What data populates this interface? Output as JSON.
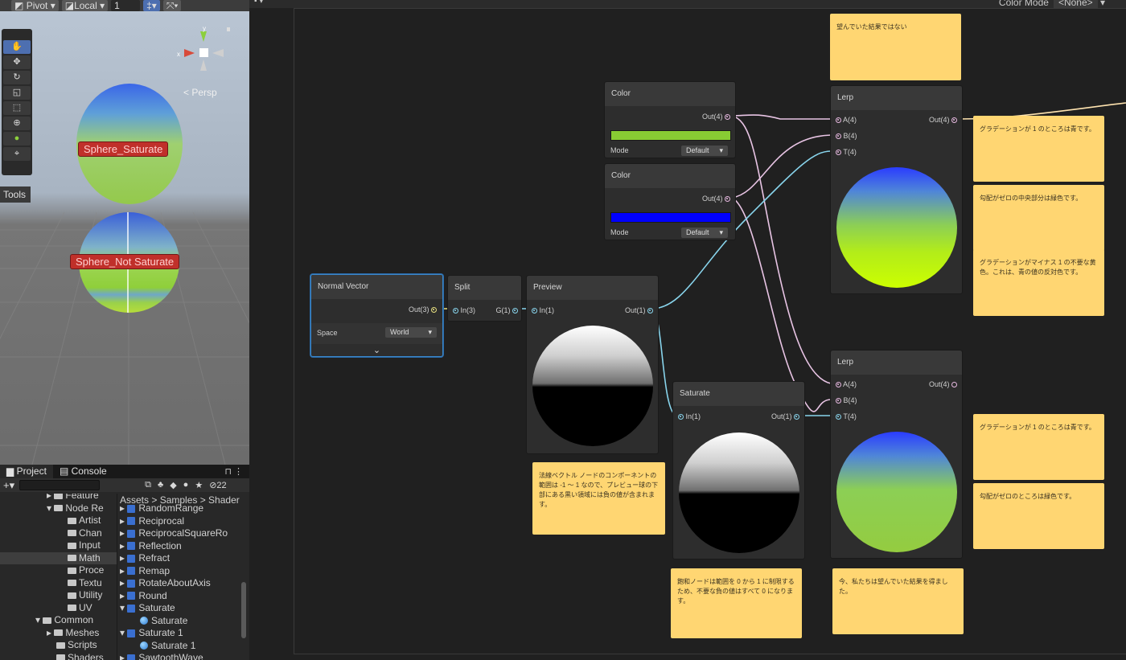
{
  "scene": {
    "toolbar": {
      "pivot": "Pivot",
      "local": "Local",
      "snap": "1"
    },
    "persp": "< Persp",
    "gizmo_x": "x",
    "gizmo_y": "y",
    "objects": {
      "top": "Sphere_Saturate",
      "bottom": "Sphere_Not Saturate"
    },
    "tools_label": "Tools"
  },
  "project": {
    "tabs": [
      "Project",
      "Console"
    ],
    "hidden_count": "22",
    "breadcrumb": "Assets > Samples > Shader",
    "tree": [
      "Feature",
      "Node Re",
      "Artist",
      "Chan",
      "Input",
      "Math",
      "Proce",
      "Textu",
      "Utility",
      "UV",
      "Common",
      "Meshes",
      "Scripts",
      "Shaders"
    ],
    "files": [
      "RandomRange",
      "Reciprocal",
      "ReciprocalSquareRo",
      "Reflection",
      "Refract",
      "Remap",
      "RotateAboutAxis",
      "Round",
      "Saturate",
      "Saturate",
      "Saturate 1",
      "Saturate 1",
      "SawtoothWave"
    ]
  },
  "graph": {
    "color_mode_label": "Color Mode",
    "color_mode_value": "<None>",
    "nodes": {
      "normal_vector": {
        "title": "Normal Vector",
        "out": "Out(3)",
        "space_label": "Space",
        "space_value": "World"
      },
      "split": {
        "title": "Split",
        "in": "In(3)",
        "out": "G(1)"
      },
      "preview": {
        "title": "Preview",
        "in": "In(1)",
        "out": "Out(1)"
      },
      "color1": {
        "title": "Color",
        "out": "Out(4)",
        "mode_label": "Mode",
        "mode_value": "Default"
      },
      "color2": {
        "title": "Color",
        "out": "Out(4)",
        "mode_label": "Mode",
        "mode_value": "Default"
      },
      "saturate": {
        "title": "Saturate",
        "in": "In(1)",
        "out": "Out(1)"
      },
      "lerp1": {
        "title": "Lerp",
        "a": "A(4)",
        "b": "B(4)",
        "t": "T(4)",
        "out": "Out(4)"
      },
      "lerp2": {
        "title": "Lerp",
        "a": "A(4)",
        "b": "B(4)",
        "t": "T(4)",
        "out": "Out(4)"
      }
    },
    "notes": {
      "top": "望んでいた結果ではない",
      "normal": "法線ベクトル ノードのコンポーネントの範囲は -1 ～ 1 なので、プレビュー球の下部にある黒い領域には負の値が含まれます。",
      "saturate": "飽和ノードは範囲を 0 から 1 に制限するため、不要な負の値はすべて 0 になります。",
      "result": "今、私たちは望んでいた結果を得ました。",
      "r1": "グラデーションが 1 のところは青です。",
      "r2": "勾配がゼロの中央部分は緑色です。",
      "r3": "グラデーションがマイナス 1 の不要な黄色。これは、青の値の反対色です。",
      "r4": "グラデーションが 1 のところは青です。",
      "r5": "勾配がゼロのところは緑色です。"
    }
  },
  "colors": {
    "color1_swatch": "#88cc33",
    "color2_swatch": "#0000ff",
    "wire_pink": "#e8c4e4",
    "wire_cyan": "#88d4ec",
    "sticky": "#ffd672"
  }
}
